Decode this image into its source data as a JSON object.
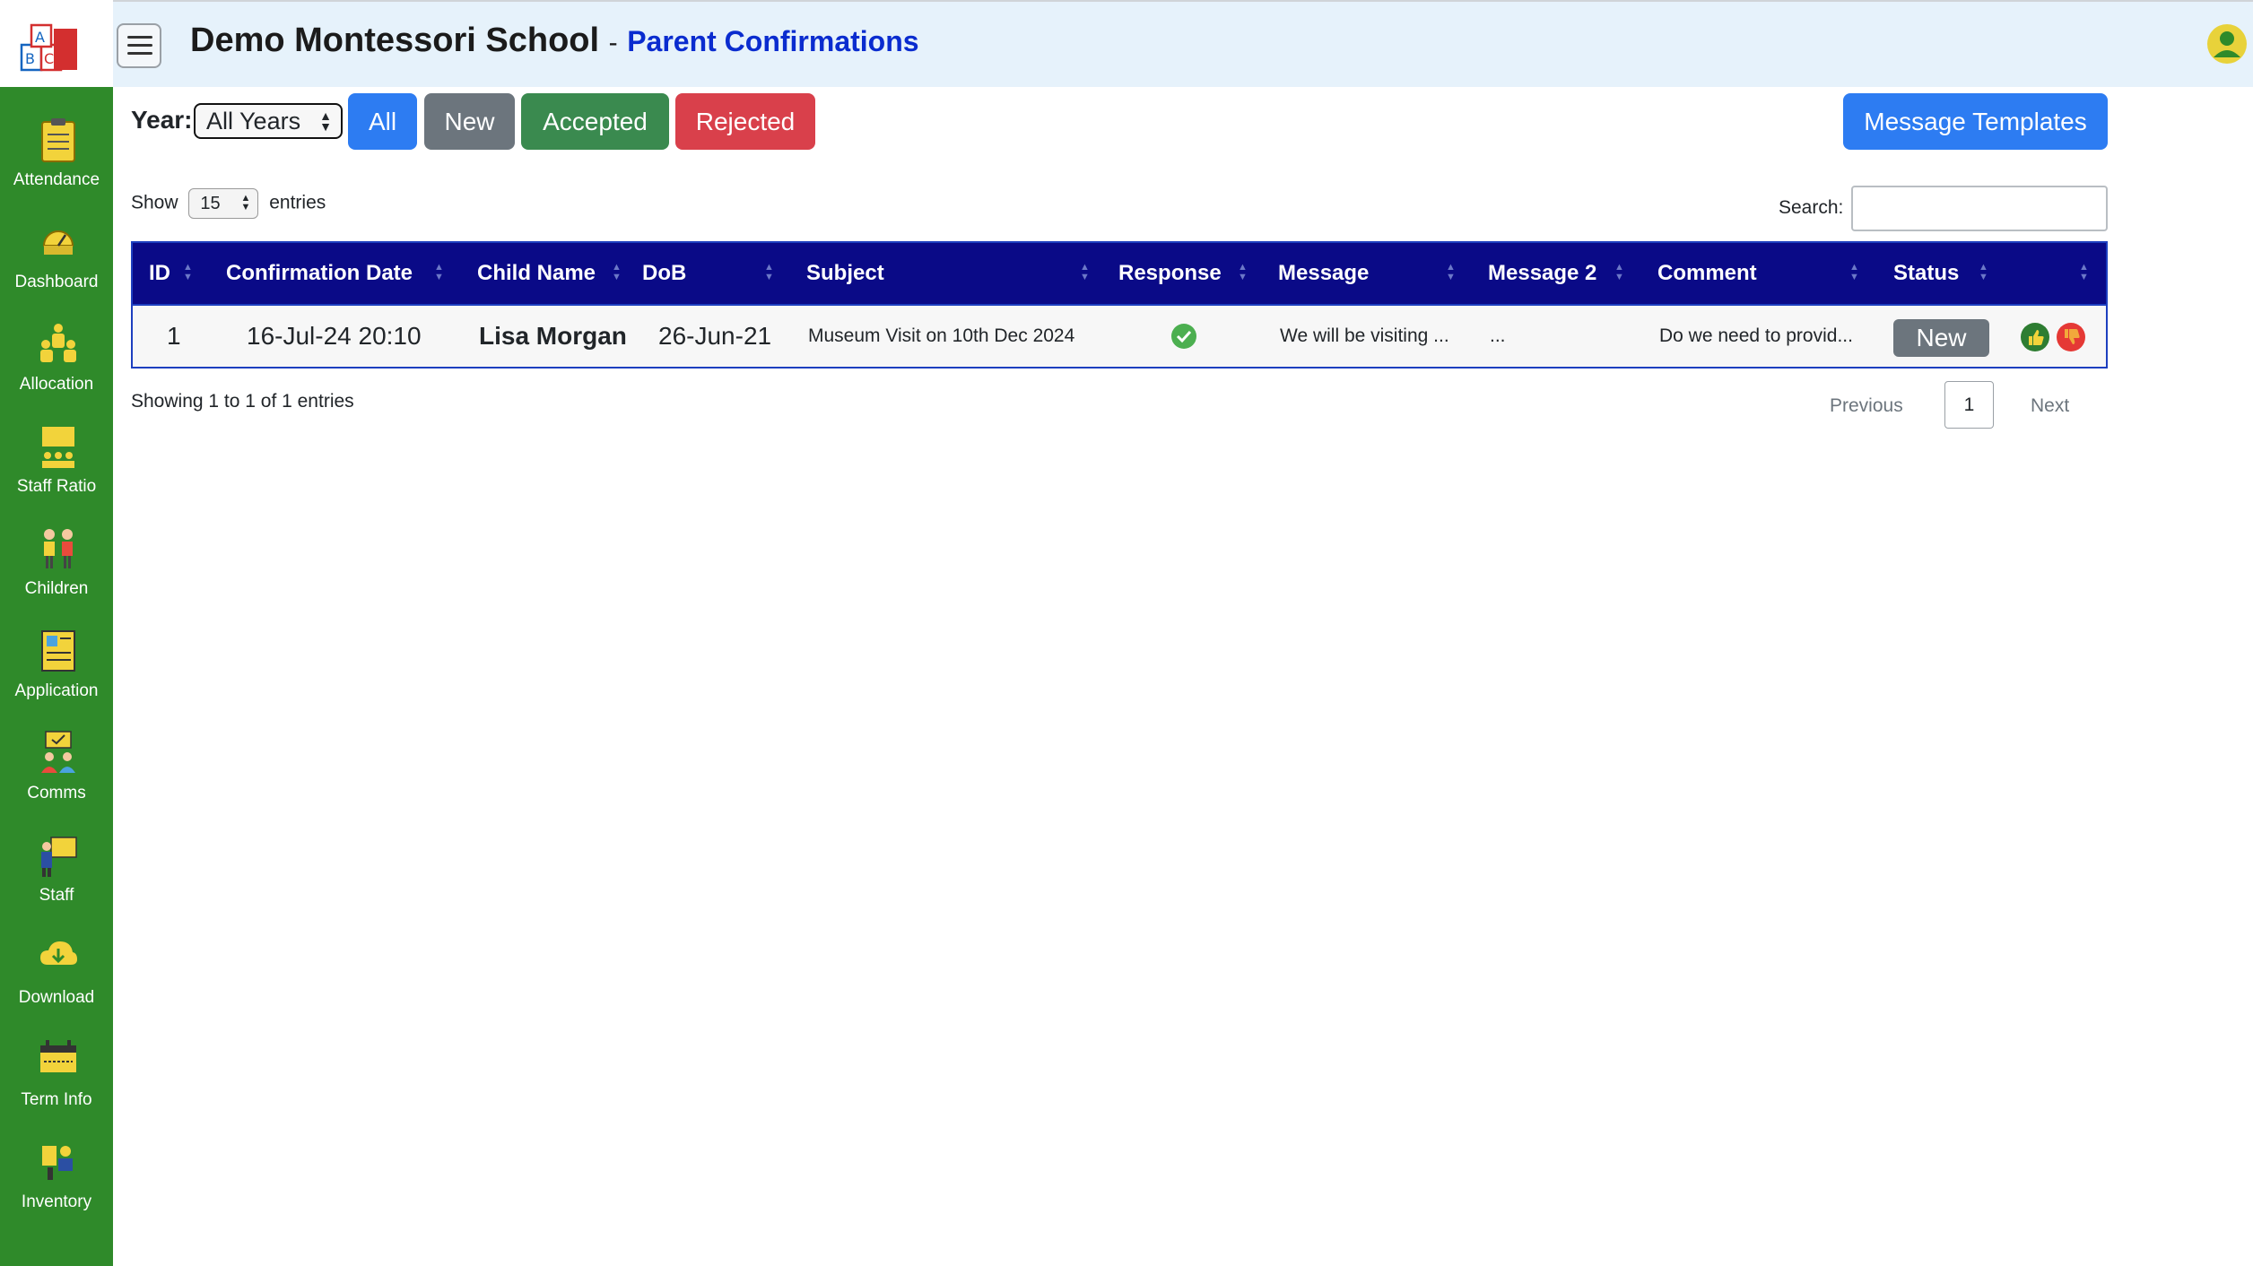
{
  "app": {
    "school_name": "Demo Montessori School",
    "separator": "-",
    "page_title": "Parent Confirmations"
  },
  "sidebar": {
    "items": [
      {
        "label": "Attendance",
        "icon": "attendance-icon"
      },
      {
        "label": "Dashboard",
        "icon": "dashboard-icon"
      },
      {
        "label": "Allocation",
        "icon": "allocation-icon"
      },
      {
        "label": "Staff Ratio",
        "icon": "staff-ratio-icon"
      },
      {
        "label": "Children",
        "icon": "children-icon"
      },
      {
        "label": "Application",
        "icon": "application-icon"
      },
      {
        "label": "Comms",
        "icon": "comms-icon"
      },
      {
        "label": "Staff",
        "icon": "staff-icon"
      },
      {
        "label": "Download",
        "icon": "download-icon"
      },
      {
        "label": "Term Info",
        "icon": "term-info-icon"
      },
      {
        "label": "Inventory",
        "icon": "inventory-icon"
      }
    ]
  },
  "toolbar": {
    "year_label": "Year:",
    "year_value": "All Years",
    "filters": {
      "all": "All",
      "new": "New",
      "accepted": "Accepted",
      "rejected": "Rejected"
    },
    "templates_label": "Message Templates"
  },
  "table_controls": {
    "show_label": "Show",
    "entries_value": "15",
    "entries_label": "entries",
    "search_label": "Search:"
  },
  "table": {
    "columns": [
      "ID",
      "Confirmation Date",
      "Child Name",
      "DoB",
      "Subject",
      "Response",
      "Message",
      "Message 2",
      "Comment",
      "Status"
    ],
    "rows": [
      {
        "id": "1",
        "confirmation_date": "16-Jul-24 20:10",
        "child_name": "Lisa Morgan",
        "dob": "26-Jun-21",
        "subject": "Museum Visit on 10th Dec 2024",
        "response": "check-circle-icon",
        "message": "We will be visiting ...",
        "message2": "...",
        "comment": "Do we need to provid...",
        "status": "New"
      }
    ]
  },
  "footer": {
    "showing": "Showing 1 to 1 of 1 entries",
    "previous": "Previous",
    "page": "1",
    "next": "Next"
  },
  "colors": {
    "sidebar": "#2f8a2a",
    "header_bg": "#e6f2fb",
    "table_header": "#0a0a87",
    "primary": "#2d7cf2",
    "secondary": "#6c757d",
    "success": "#3a8a4f",
    "danger": "#d9404b"
  }
}
